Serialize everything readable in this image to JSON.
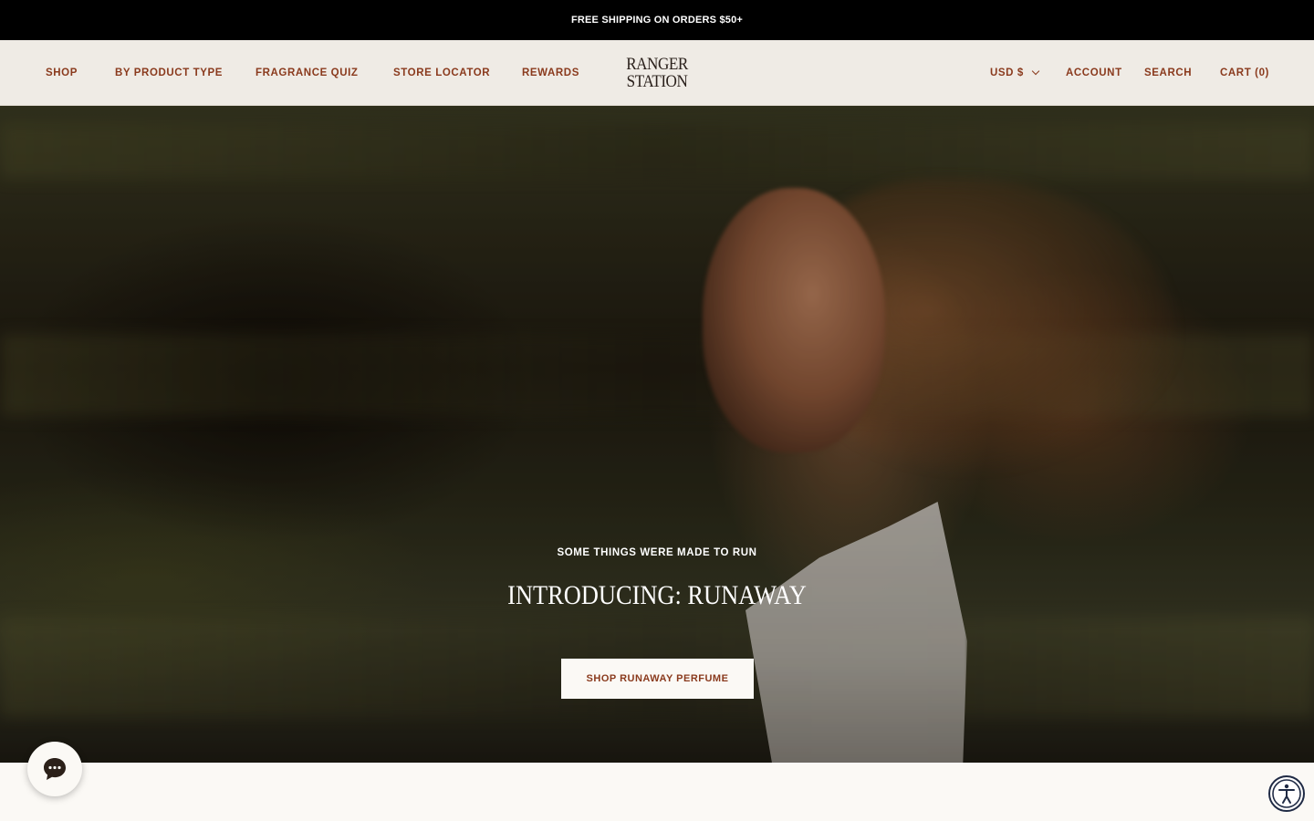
{
  "announcement": {
    "text": "FREE SHIPPING ON ORDERS $50+"
  },
  "header": {
    "nav_left": [
      {
        "label": "SHOP"
      },
      {
        "label": "BY PRODUCT TYPE"
      },
      {
        "label": "FRAGRANCE QUIZ"
      },
      {
        "label": "STORE LOCATOR"
      },
      {
        "label": "REWARDS"
      }
    ],
    "logo": {
      "line1": "RANGER",
      "line2": "STATION"
    },
    "currency": {
      "label": "USD $"
    },
    "account_label": "ACCOUNT",
    "search_label": "SEARCH",
    "cart_label": "CART (0)"
  },
  "hero": {
    "eyebrow": "SOME THINGS WERE MADE TO RUN",
    "title": "INTRODUCING: RUNAWAY",
    "cta_label": "SHOP RUNAWAY PERFUME"
  },
  "widgets": {
    "chat_icon": "chat-bubble-icon",
    "accessibility_icon": "accessibility-icon"
  },
  "colors": {
    "announcement_bg": "#000000",
    "header_bg": "#efebe5",
    "nav_text": "#8a3a1d",
    "logo_text": "#2a201b",
    "cta_bg": "#fbf9f5",
    "cta_text": "#8a3a1d",
    "page_bg": "#fbf9f5"
  }
}
